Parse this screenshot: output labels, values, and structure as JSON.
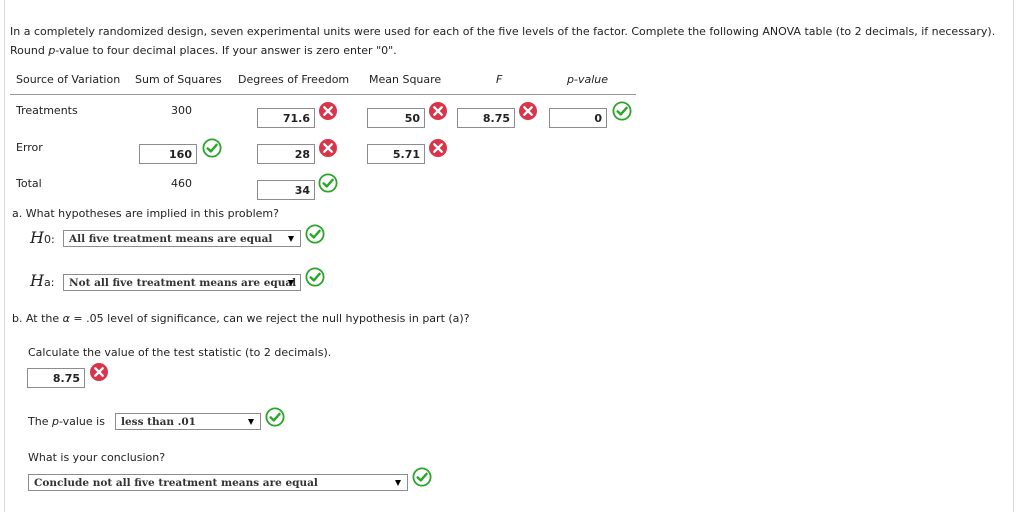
{
  "intro": {
    "line1": "In a completely randomized design, seven experimental units were used for each of the five levels of the factor. Complete the following ANOVA table (to 2 decimals, if necessary). Round ",
    "italic_p": "p",
    "line2": "-value to four decimal places. If your answer is zero enter \"0\"."
  },
  "table": {
    "headers": {
      "source": "Source of Variation",
      "ss": "Sum of Squares",
      "df": "Degrees of Freedom",
      "ms": "Mean Square",
      "f": "F",
      "p": "p-value"
    },
    "treatments": {
      "label": "Treatments",
      "ss": "300",
      "df": "71.6",
      "ms": "50",
      "f": "8.75",
      "p": "0"
    },
    "error": {
      "label": "Error",
      "ss": "160",
      "df": "28",
      "ms": "5.71"
    },
    "total": {
      "label": "Total",
      "ss": "460",
      "df": "34"
    }
  },
  "part_a": {
    "question": "a. What hypotheses are implied in this problem?",
    "h0_label": "H",
    "h0_sub": "0:",
    "h0_value": "All five treatment means are equal",
    "ha_label": "H",
    "ha_sub": "a:",
    "ha_value": "Not all five treatment means are equal"
  },
  "part_b": {
    "question_prefix": "b. At the ",
    "alpha": "α",
    "question_suffix": " = .05 level of significance, can we reject the null hypothesis in part (a)?",
    "calc_prompt": "Calculate the value of the test statistic (to 2 decimals).",
    "test_stat": "8.75",
    "pvalue_prefix": "The ",
    "pvalue_italic": "p",
    "pvalue_suffix": "-value is",
    "pvalue_choice": "less than .01",
    "conclusion_prompt": "What is your conclusion?",
    "conclusion_choice": "Conclude not all five treatment means are equal"
  },
  "colors": {
    "correct": "#2aa52a",
    "incorrect": "#d9344a"
  },
  "icons": {
    "correct": "check-circle-icon",
    "incorrect": "x-circle-icon"
  }
}
